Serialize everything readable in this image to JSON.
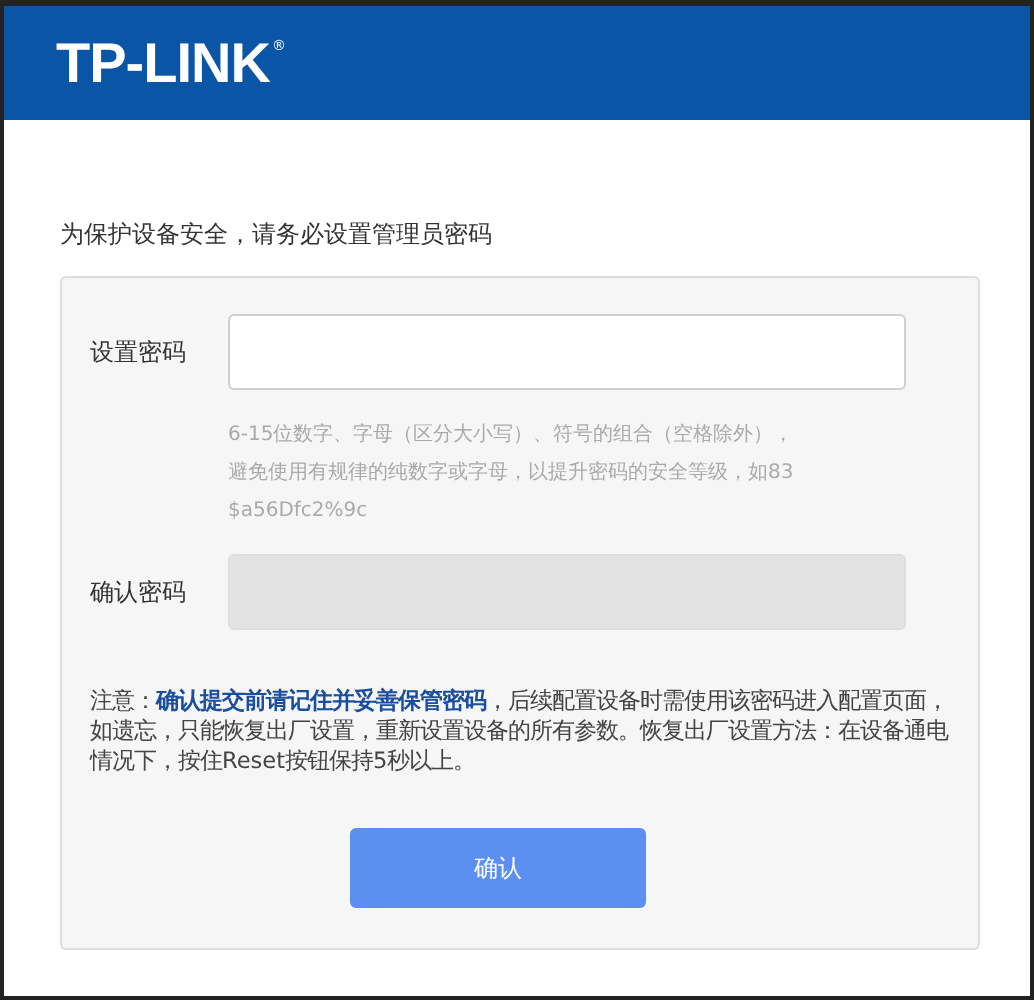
{
  "header": {
    "logo": "TP-LINK",
    "logo_mark": "®"
  },
  "intro": "为保护设备安全，请务必设置管理员密码",
  "fields": [
    {
      "label": "设置密码",
      "disabled": false
    },
    {
      "label": "确认密码",
      "disabled": true
    }
  ],
  "hint": [
    "6-15位数字、字母（区分大小写）、符号的组合（空格除外），",
    "避免使用有规律的纯数字或字母，以提升密码的安全等级，如83",
    "$a56Dfc2%9c"
  ],
  "notice": {
    "lead": "注意：",
    "emphasis": "确认提交前请记住并妥善保管密码",
    "rest": "，后续配置设备时需使用该密码进入配置页面，如遗忘，只能恢复出厂设置，重新设置设备的所有参数。恢复出厂设置方法：在设备通电情况下，按住Reset按钮保持5秒以上。"
  },
  "button": "确认"
}
